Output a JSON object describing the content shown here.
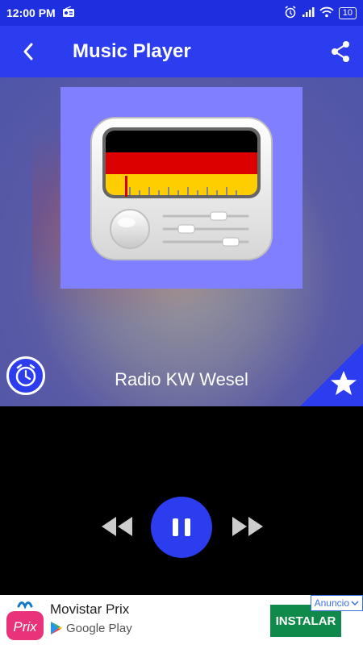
{
  "status_bar": {
    "time": "12:00 PM",
    "battery": "10"
  },
  "app_bar": {
    "title": "Music Player"
  },
  "player": {
    "station_name": "Radio KW Wesel",
    "state": "playing"
  },
  "ad": {
    "title": "Movistar Prix",
    "logo_text": "Prix",
    "store": "Google Play",
    "install_label": "INSTALAR",
    "ad_label": "Anuncio"
  },
  "colors": {
    "primary": "#2b3dee",
    "status_bar": "#1e2fe0",
    "install_button": "#0f8a4a"
  }
}
